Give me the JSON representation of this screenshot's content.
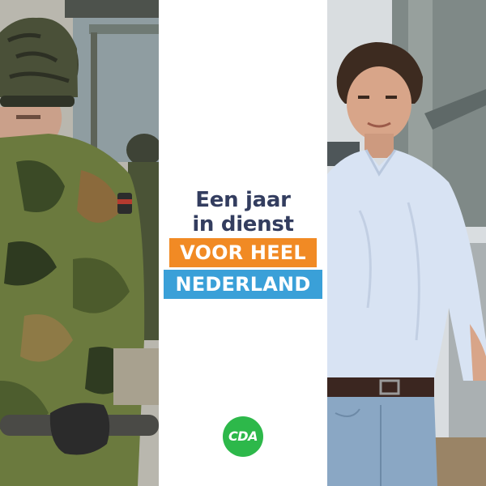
{
  "headline": {
    "line1": "Een jaar",
    "line2": "in dienst"
  },
  "tags": {
    "orange": "VOOR HEEL",
    "blue": "NEDERLAND"
  },
  "logo": {
    "text": "CDA"
  },
  "colors": {
    "headline": "#333d5f",
    "orange_band": "#f18a24",
    "blue_band": "#3aa0d8",
    "logo_green": "#2db84a"
  }
}
